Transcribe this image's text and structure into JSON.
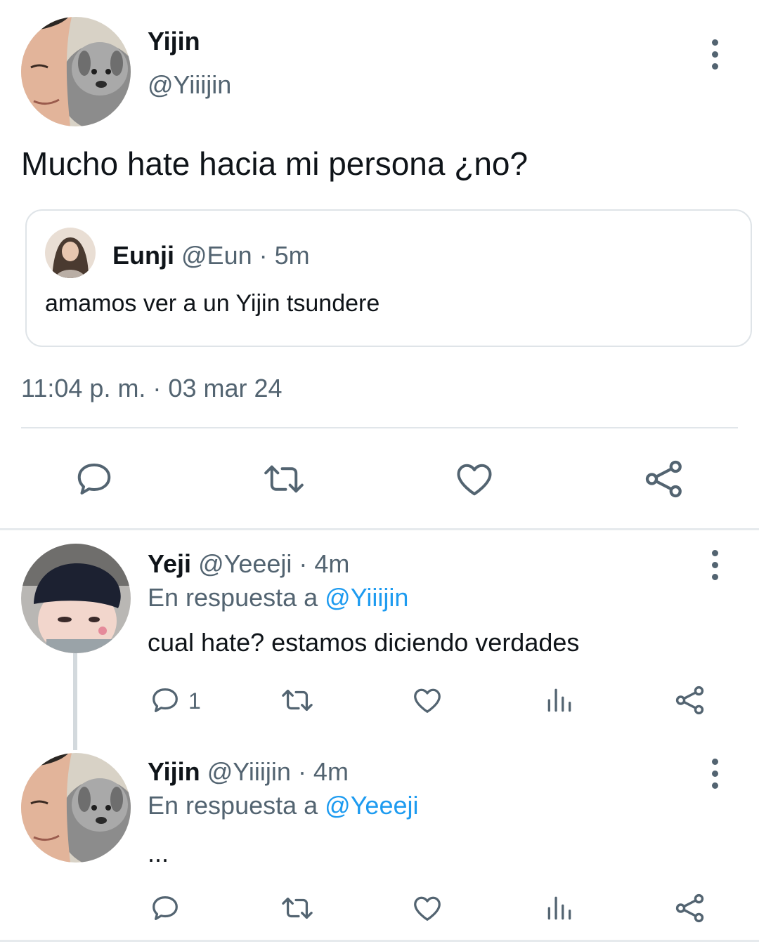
{
  "main_tweet": {
    "author_name": "Yijin",
    "author_handle": "@Yiiijin",
    "text": "Mucho hate hacia mi persona ¿no?",
    "timestamp": "11:04 p. m. · 03 mar 24",
    "quoted": {
      "author_name": "Eunji",
      "author_handle": "@Eun",
      "time": "· 5m",
      "text": "amamos ver a un Yijin tsundere"
    },
    "actions": [
      "reply-icon",
      "retweet-icon",
      "like-icon",
      "share-icon"
    ]
  },
  "replies": [
    {
      "author_name": "Yeji",
      "author_handle": "@Yeeeji",
      "time": "· 4m",
      "reply_prefix": "En respuesta a",
      "reply_to": "@Yiiijin",
      "text": "cual hate? estamos diciendo verdades",
      "reply_count": "1",
      "actions": [
        "reply-icon",
        "retweet-icon",
        "like-icon",
        "analytics-icon",
        "share-icon"
      ]
    },
    {
      "author_name": "Yijin",
      "author_handle": "@Yiiijin",
      "time": "· 4m",
      "reply_prefix": "En respuesta a",
      "reply_to": "@Yeeeji",
      "text": "...",
      "actions": [
        "reply-icon",
        "retweet-icon",
        "like-icon",
        "analytics-icon",
        "share-icon"
      ]
    }
  ],
  "colors": {
    "text": "#0f1419",
    "secondary": "#536471",
    "accent": "#1d9bf0",
    "divider": "#eff3f4"
  }
}
